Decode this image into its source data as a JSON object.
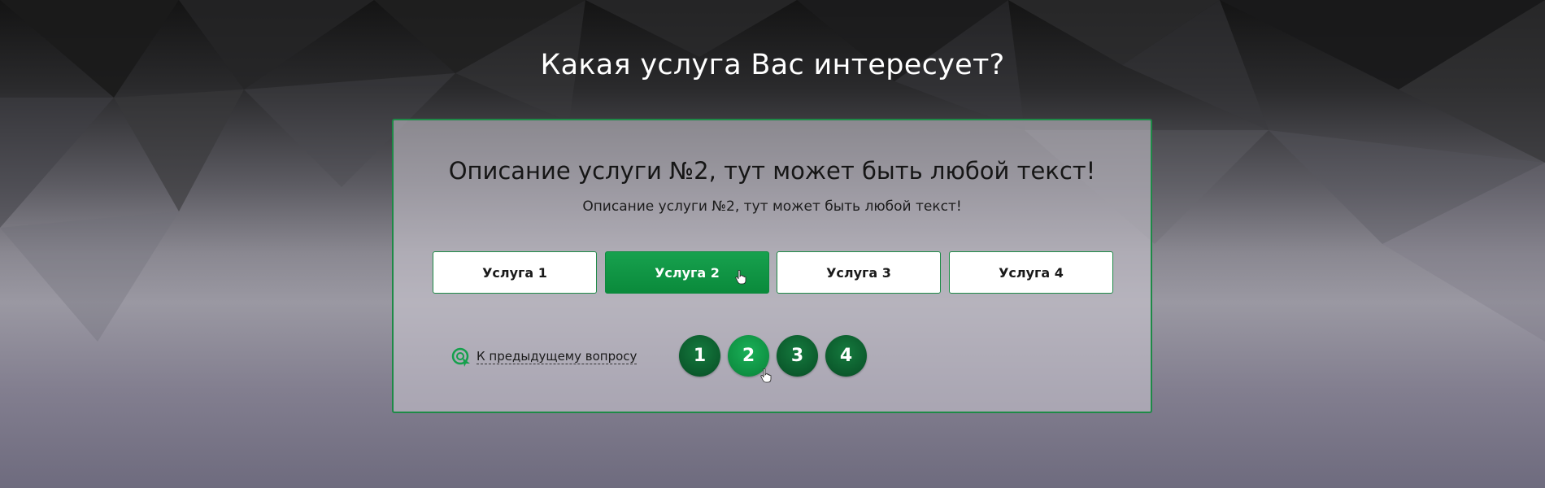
{
  "page": {
    "title": "Какая услуга Вас интересует?"
  },
  "card": {
    "title": "Описание услуги №2, тут может быть любой текст!",
    "subtitle": "Описание услуги №2, тут может быть любой текст!"
  },
  "options": [
    {
      "label": "Услуга 1",
      "selected": false
    },
    {
      "label": "Услуга 2",
      "selected": true
    },
    {
      "label": "Услуга 3",
      "selected": false
    },
    {
      "label": "Услуга 4",
      "selected": false
    }
  ],
  "back_link": {
    "label": "К предыдущему вопросу",
    "icon": "refresh-arrow-icon"
  },
  "pagination": {
    "pages": [
      "1",
      "2",
      "3",
      "4"
    ],
    "current": "2"
  },
  "colors": {
    "accent": "#0e9042",
    "accent_dark": "#0b5a2c",
    "border": "#1e8a47"
  }
}
